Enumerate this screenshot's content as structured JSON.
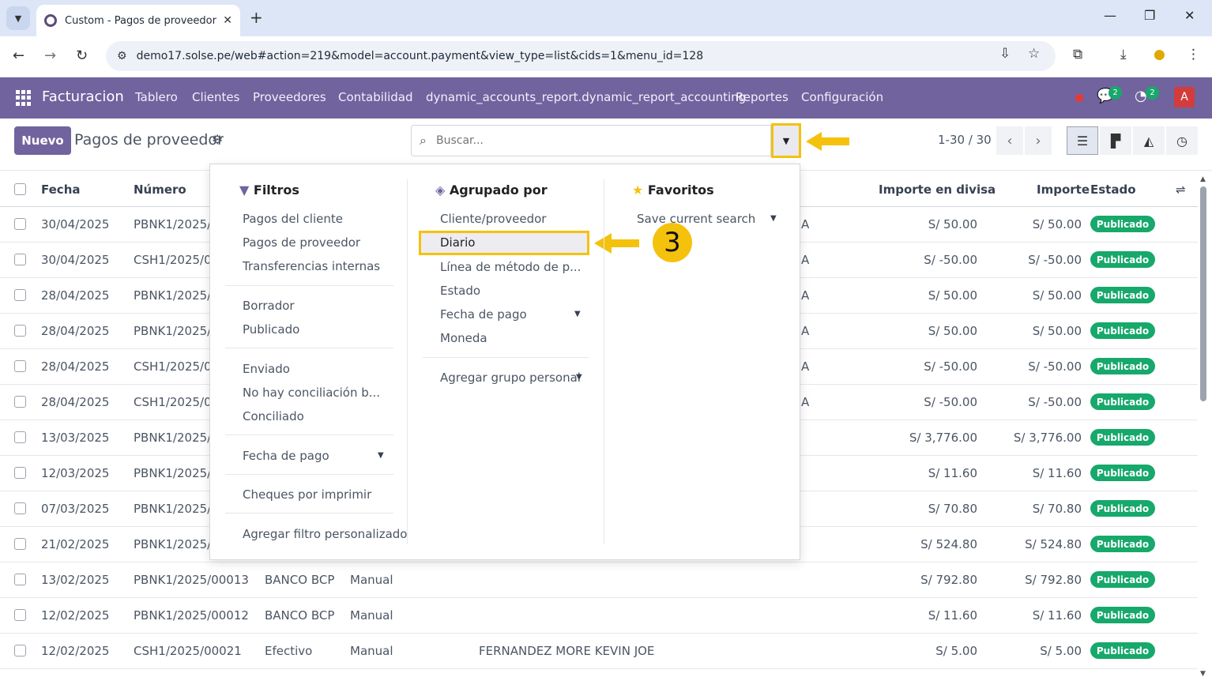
{
  "browser": {
    "tab_title": "Custom - Pagos de proveedor",
    "url": "demo17.solse.pe/web#action=219&model=account.payment&view_type=list&cids=1&menu_id=128"
  },
  "navbar": {
    "brand": "Facturacion",
    "menu": [
      "Tablero",
      "Clientes",
      "Proveedores",
      "Contabilidad",
      "dynamic_accounts_report.dynamic_report_accounting",
      "Reportes",
      "Configuración"
    ],
    "messages_count": "2",
    "activities_count": "2",
    "avatar_letter": "A"
  },
  "control_panel": {
    "new_button": "Nuevo",
    "title": "Pagos de proveedor",
    "search_placeholder": "Buscar...",
    "pager": "1-30 / 30"
  },
  "annotation": {
    "step_number": "3"
  },
  "table": {
    "headers": {
      "fecha": "Fecha",
      "numero": "Número",
      "importe_divisa": "Importe en divisa",
      "importe": "Importe",
      "estado": "Estado"
    },
    "rows": [
      {
        "fecha": "30/04/2025",
        "numero": "PBNK1/2025/0",
        "diario": "",
        "metodo": "",
        "partner": "",
        "partner_tail": "A",
        "divisa": "S/ 50.00",
        "importe": "S/ 50.00",
        "estado": "Publicado"
      },
      {
        "fecha": "30/04/2025",
        "numero": "CSH1/2025/00",
        "diario": "",
        "metodo": "",
        "partner": "",
        "partner_tail": "A",
        "divisa": "S/ -50.00",
        "importe": "S/ -50.00",
        "estado": "Publicado"
      },
      {
        "fecha": "28/04/2025",
        "numero": "PBNK1/2025/0",
        "diario": "",
        "metodo": "",
        "partner": "",
        "partner_tail": "A",
        "divisa": "S/ 50.00",
        "importe": "S/ 50.00",
        "estado": "Publicado"
      },
      {
        "fecha": "28/04/2025",
        "numero": "PBNK1/2025/0",
        "diario": "",
        "metodo": "",
        "partner": "",
        "partner_tail": "A",
        "divisa": "S/ 50.00",
        "importe": "S/ 50.00",
        "estado": "Publicado"
      },
      {
        "fecha": "28/04/2025",
        "numero": "CSH1/2025/00",
        "diario": "",
        "metodo": "",
        "partner": "",
        "partner_tail": "A",
        "divisa": "S/ -50.00",
        "importe": "S/ -50.00",
        "estado": "Publicado"
      },
      {
        "fecha": "28/04/2025",
        "numero": "CSH1/2025/00",
        "diario": "",
        "metodo": "",
        "partner": "",
        "partner_tail": "A",
        "divisa": "S/ -50.00",
        "importe": "S/ -50.00",
        "estado": "Publicado"
      },
      {
        "fecha": "13/03/2025",
        "numero": "PBNK1/2025/0",
        "diario": "",
        "metodo": "",
        "partner": "",
        "partner_tail": "",
        "divisa": "S/ 3,776.00",
        "importe": "S/ 3,776.00",
        "estado": "Publicado"
      },
      {
        "fecha": "12/03/2025",
        "numero": "PBNK1/2025/0",
        "diario": "",
        "metodo": "",
        "partner": "",
        "partner_tail": "",
        "divisa": "S/ 11.60",
        "importe": "S/ 11.60",
        "estado": "Publicado"
      },
      {
        "fecha": "07/03/2025",
        "numero": "PBNK1/2025/0",
        "diario": "",
        "metodo": "",
        "partner": "",
        "partner_tail": "",
        "divisa": "S/ 70.80",
        "importe": "S/ 70.80",
        "estado": "Publicado"
      },
      {
        "fecha": "21/02/2025",
        "numero": "PBNK1/2025/0",
        "diario": "",
        "metodo": "",
        "partner": "",
        "partner_tail": "",
        "divisa": "S/ 524.80",
        "importe": "S/ 524.80",
        "estado": "Publicado"
      },
      {
        "fecha": "13/02/2025",
        "numero": "PBNK1/2025/00013",
        "diario": "BANCO BCP",
        "metodo": "Manual",
        "partner": "",
        "partner_tail": "",
        "divisa": "S/ 792.80",
        "importe": "S/ 792.80",
        "estado": "Publicado"
      },
      {
        "fecha": "12/02/2025",
        "numero": "PBNK1/2025/00012",
        "diario": "BANCO BCP",
        "metodo": "Manual",
        "partner": "",
        "partner_tail": "",
        "divisa": "S/ 11.60",
        "importe": "S/ 11.60",
        "estado": "Publicado"
      },
      {
        "fecha": "12/02/2025",
        "numero": "CSH1/2025/00021",
        "diario": "Efectivo",
        "metodo": "Manual",
        "partner": "FERNANDEZ MORE KEVIN JOE",
        "partner_tail": "",
        "divisa": "S/ 5.00",
        "importe": "S/ 5.00",
        "estado": "Publicado"
      }
    ]
  },
  "dropdown": {
    "filters": {
      "title": "Filtros",
      "group1": [
        "Pagos del cliente",
        "Pagos de proveedor",
        "Transferencias internas"
      ],
      "group2": [
        "Borrador",
        "Publicado"
      ],
      "group3": [
        "Enviado",
        "No hay conciliación b...",
        "Conciliado"
      ],
      "date_filter": "Fecha de pago",
      "cheques": "Cheques por imprimir",
      "custom": "Agregar filtro personalizado"
    },
    "groupby": {
      "title": "Agrupado por",
      "items": [
        "Cliente/proveedor",
        "Diario",
        "Línea de método de p...",
        "Estado",
        "Fecha de pago",
        "Moneda"
      ],
      "custom": "Agregar grupo personal"
    },
    "favorites": {
      "title": "Favoritos",
      "save": "Save current search"
    }
  }
}
